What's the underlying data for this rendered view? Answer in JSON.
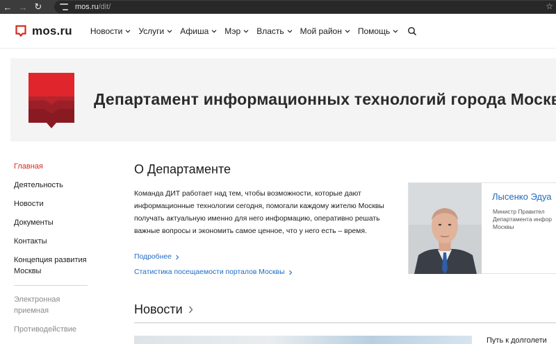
{
  "browser": {
    "back_icon": "arrow-left-icon",
    "forward_icon": "arrow-right-icon",
    "reload_icon": "reload-icon",
    "url_host": "mos.ru",
    "url_path": "/dit/"
  },
  "header": {
    "logo_text": "mos.ru",
    "brand_color": "#d52b1e",
    "menu": [
      {
        "label": "Новости"
      },
      {
        "label": "Услуги"
      },
      {
        "label": "Афиша"
      },
      {
        "label": "Мэр"
      },
      {
        "label": "Власть"
      },
      {
        "label": "Мой район"
      },
      {
        "label": "Помощь"
      }
    ],
    "search_icon": "search-icon"
  },
  "hero": {
    "title": "Департамент информационных технологий города Москвы"
  },
  "sidebar": {
    "items": [
      {
        "label": "Главная",
        "active": true
      },
      {
        "label": "Деятельность"
      },
      {
        "label": "Новости"
      },
      {
        "label": "Документы"
      },
      {
        "label": "Контакты"
      },
      {
        "label": "Концепция развития Москвы"
      }
    ],
    "extra": [
      {
        "label": "Электронная приемная"
      },
      {
        "label": "Противодействие"
      }
    ]
  },
  "about": {
    "title": "О Департаменте",
    "text": "Команда ДИТ работает над тем, чтобы возможности, которые дают информационные технологии сегодня, помогали каждому жителю Москвы получать актуальную именно для него информацию, оперативно решать важные вопросы и экономить самое ценное, что у него есть – время.",
    "more_link": "Подробнее",
    "stats_link": "Статистика посещаемости порталов Москвы"
  },
  "minister": {
    "name": "Лысенко Эдуа",
    "role_lines": [
      "Министр Правител",
      "Департамента инфор",
      "Москвы"
    ]
  },
  "news": {
    "title": "Новости",
    "first_item_title": "Путь к долголети"
  }
}
